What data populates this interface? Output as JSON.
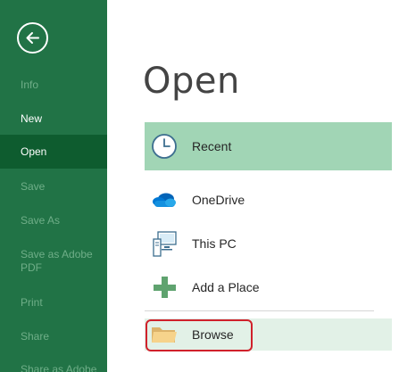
{
  "sidebar": {
    "back_icon": "back-arrow-icon",
    "items": [
      {
        "label": "Info",
        "state": "disabled"
      },
      {
        "label": "New",
        "state": "enabled"
      },
      {
        "label": "Open",
        "state": "selected"
      },
      {
        "label": "Save",
        "state": "disabled"
      },
      {
        "label": "Save As",
        "state": "disabled"
      },
      {
        "label": "Save as Adobe PDF",
        "state": "disabled"
      },
      {
        "label": "Print",
        "state": "disabled"
      },
      {
        "label": "Share",
        "state": "disabled"
      },
      {
        "label": "Share as Adobe",
        "state": "disabled"
      }
    ]
  },
  "main": {
    "title": "Open",
    "locations": [
      {
        "label": "Recent",
        "icon": "clock-icon"
      },
      {
        "label": "OneDrive",
        "icon": "cloud-icon"
      },
      {
        "label": "This PC",
        "icon": "computer-icon"
      },
      {
        "label": "Add a Place",
        "icon": "plus-icon"
      },
      {
        "label": "Browse",
        "icon": "folder-icon"
      }
    ]
  },
  "colors": {
    "sidebar_bg": "#217346",
    "sidebar_selected": "#0e5c2f",
    "recent_bg": "#a1d5b5",
    "browse_bg": "#e2f1e7",
    "highlight": "#d0212b"
  }
}
